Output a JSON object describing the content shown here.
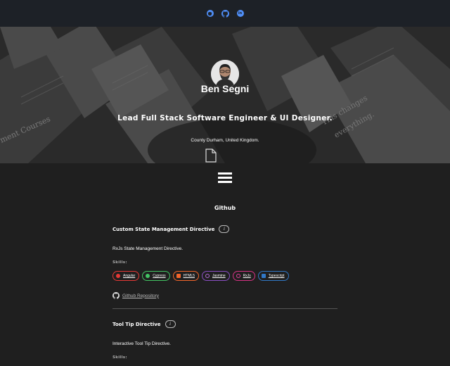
{
  "colors": {
    "page_background": "#1f1f1f",
    "topbar_background": "#1d2127",
    "social_accent": "#4f8ef7"
  },
  "topbar": {
    "icons": [
      {
        "name": "discord-icon",
        "glyph": "✉"
      },
      {
        "name": "github-icon",
        "glyph": "●"
      },
      {
        "name": "linkedin-icon",
        "glyph": "in"
      }
    ]
  },
  "hero": {
    "name": "Ben Segni",
    "role": "Lead Full Stack Software Engineer & UI Designer.",
    "location": "County Durham, United Kingdom.",
    "background_text": [
      "ment Courses",
      "This changes",
      "everything."
    ]
  },
  "main": {
    "section_title": "Github",
    "projects": [
      {
        "title": "Custom State Management Directive",
        "info": "i",
        "description": "RxJs State Management Directive.",
        "skills_label": "Skills:",
        "skills": [
          {
            "label": "Angular",
            "color": "#e53935",
            "icon": "angular-icon"
          },
          {
            "label": "Cypress",
            "color": "#43c463",
            "icon": "cypress-icon"
          },
          {
            "label": "HTML5",
            "color": "#f2652b",
            "icon": "html5-icon"
          },
          {
            "label": "Jasmine",
            "color": "#8a4fc4",
            "icon": "jasmine-icon"
          },
          {
            "label": "RxJs",
            "color": "#d63384",
            "icon": "rxjs-icon"
          },
          {
            "label": "Typescript",
            "color": "#3178c6",
            "icon": "typescript-icon"
          }
        ],
        "repo_label": "Github Repository"
      },
      {
        "title": "Tool Tip Directive",
        "info": "i",
        "description": "Interactive Tool Tip Directive.",
        "skills_label": "Skills:"
      }
    ]
  }
}
